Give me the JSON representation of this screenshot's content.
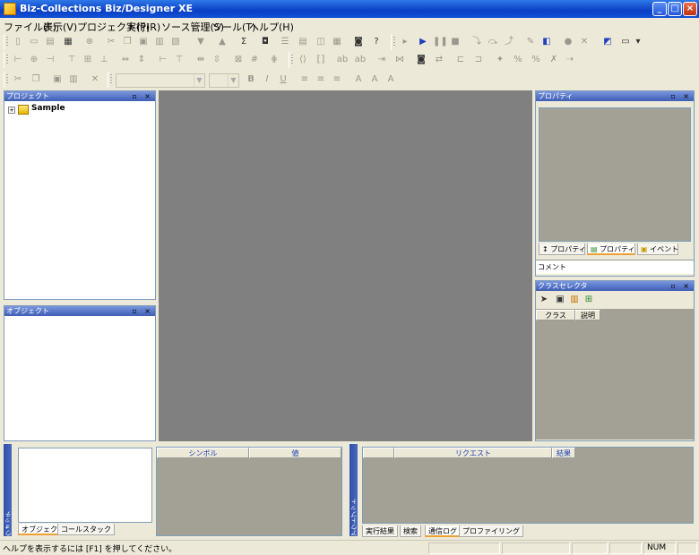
{
  "window": {
    "title": "Biz-Collections Biz/Designer XE",
    "min_glyph": "_",
    "max_glyph": "□",
    "close_glyph": "×"
  },
  "menu": [
    "ファイル(F)",
    "表示(V)",
    "プロジェクト(P)",
    "実行(R)",
    "ソース管理(S)",
    "ツール(T)",
    "ヘルプ(H)"
  ],
  "panels": {
    "project": {
      "title": "プロジェクト",
      "tree": [
        {
          "label": "Sample",
          "expander": "+"
        }
      ]
    },
    "object": {
      "title": "オブジェクト"
    },
    "property": {
      "title": "プロパティ",
      "tabs": [
        "プロパティ",
        "プロパティ",
        "イベント"
      ],
      "comment_label": "コメント"
    },
    "class_selector": {
      "title": "クラスセレクタ",
      "columns": [
        "クラス",
        "説明"
      ]
    },
    "watch": {
      "side_label": "ウォッチ",
      "tabs": [
        "オブジェクト",
        "コールスタック"
      ],
      "columns": [
        "シンボル",
        "値"
      ]
    },
    "output": {
      "side_label": "アウトプット",
      "columns": [
        "",
        "リクエスト",
        "結果"
      ],
      "tabs": [
        "実行結果",
        "検索",
        "通信ログ",
        "プロファイリング"
      ]
    }
  },
  "panel_controls": "▫ ×",
  "statusbar": {
    "message": "ヘルプを表示するには [F1] を押してください。",
    "num": "NUM"
  },
  "colors": {
    "accent": "#3e5fb4",
    "workspace": "#808080",
    "panel_gray": "#a3a195"
  }
}
